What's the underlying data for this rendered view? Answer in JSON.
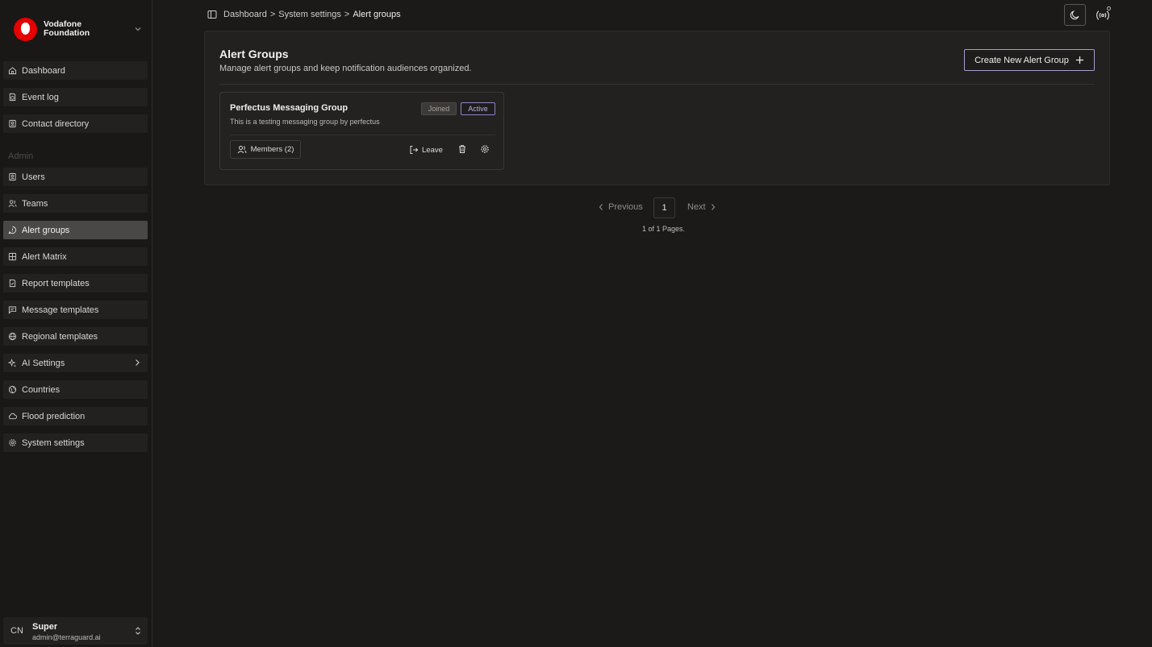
{
  "brand": {
    "line1": "Vodafone",
    "line2": "Foundation",
    "logo_color": "#e60000"
  },
  "nav": {
    "items": [
      {
        "label": "Dashboard",
        "icon": "home-icon"
      },
      {
        "label": "Event log",
        "icon": "event-log-icon"
      },
      {
        "label": "Contact directory",
        "icon": "contact-directory-icon"
      }
    ],
    "section_label": "Admin",
    "admin_items": [
      {
        "label": "Users",
        "icon": "users-icon"
      },
      {
        "label": "Teams",
        "icon": "teams-icon"
      },
      {
        "label": "Alert groups",
        "icon": "alert-groups-icon",
        "active": true
      },
      {
        "label": "Alert Matrix",
        "icon": "grid-icon"
      },
      {
        "label": "Report templates",
        "icon": "report-icon"
      },
      {
        "label": "Message templates",
        "icon": "message-icon"
      },
      {
        "label": "Regional templates",
        "icon": "globe-icon"
      },
      {
        "label": "AI Settings",
        "icon": "sparkles-icon"
      },
      {
        "label": "Countries",
        "icon": "countries-icon"
      },
      {
        "label": "Flood prediction",
        "icon": "cloud-icon"
      },
      {
        "label": "System settings",
        "icon": "gear-icon"
      }
    ]
  },
  "user": {
    "initials": "CN",
    "name": "Super",
    "email": "admin@terraguard.ai"
  },
  "breadcrumb": {
    "items": [
      "Dashboard",
      "System settings"
    ],
    "current": "Alert groups",
    "separator": ">"
  },
  "page": {
    "title": "Alert Groups",
    "description": "Manage alert groups and keep notification audiences organized.",
    "create_button": "Create New Alert Group"
  },
  "groups": [
    {
      "name": "Perfectus Messaging Group",
      "description": "This is a testing messaging group by perfectus",
      "badge_joined": "Joined",
      "badge_active": "Active",
      "members_label": "Members (2)",
      "leave_label": "Leave"
    }
  ],
  "pagination": {
    "previous": "Previous",
    "current_page": "1",
    "next": "Next",
    "summary": "1 of 1 Pages."
  },
  "colors": {
    "accent": "#a89ccd",
    "background": "#1c1a19",
    "active_nav": "#4a4846"
  }
}
